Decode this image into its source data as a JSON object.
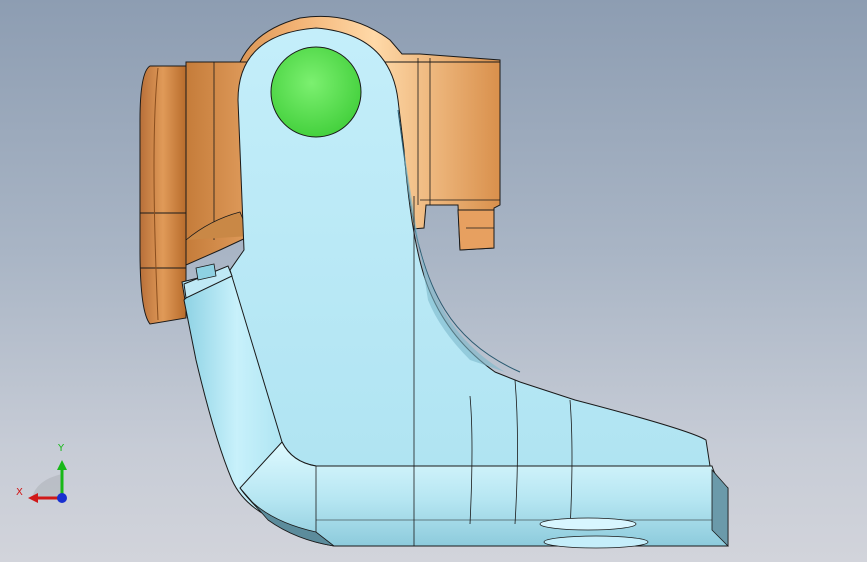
{
  "viewport": {
    "background_top": "#8d9db2",
    "background_bottom": "#d2d4db"
  },
  "model": {
    "bracket_color": "#e8a868",
    "arm_color": "#aee4f2",
    "hole_color": "#5ee855",
    "edge_color": "#1a1a1a"
  },
  "triad": {
    "x_label": "X",
    "y_label": "Y",
    "x_color": "#d01818",
    "y_color": "#18b818",
    "z_color": "#1830d0",
    "icons": [
      "triad-x-axis-icon",
      "triad-y-axis-icon",
      "triad-z-axis-icon"
    ]
  }
}
